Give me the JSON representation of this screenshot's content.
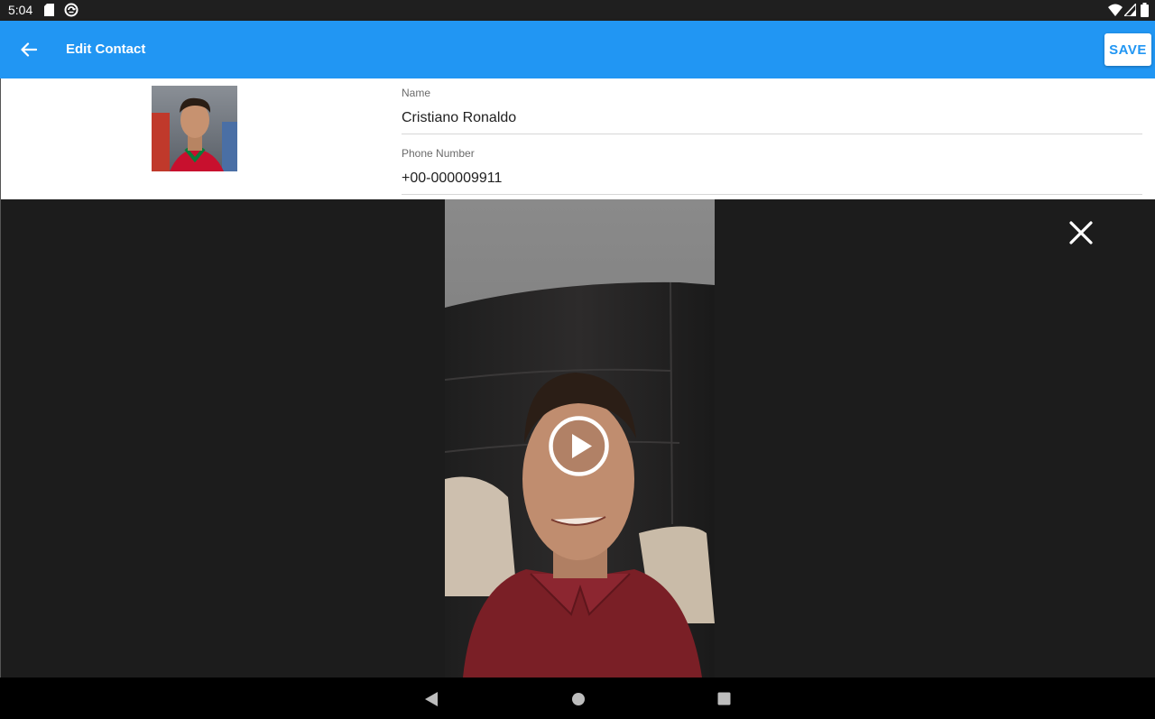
{
  "status_bar": {
    "time": "5:04",
    "icons": [
      "sd-card-icon",
      "sync-icon",
      "wifi-icon",
      "cell-signal-icon",
      "battery-icon"
    ]
  },
  "app_bar": {
    "title": "Edit Contact",
    "save_label": "SAVE",
    "color": "#2196f3",
    "back_icon": "arrow-back-icon"
  },
  "contact": {
    "name_label": "Name",
    "name_value": "Cristiano Ronaldo",
    "phone_label": "Phone Number",
    "phone_value": "+00-000009911"
  },
  "video_overlay": {
    "close_icon": "close-icon",
    "play_icon": "play-circle-icon"
  },
  "nav_bar": {
    "icons": [
      "nav-back-icon",
      "nav-home-icon",
      "nav-recents-icon"
    ]
  }
}
